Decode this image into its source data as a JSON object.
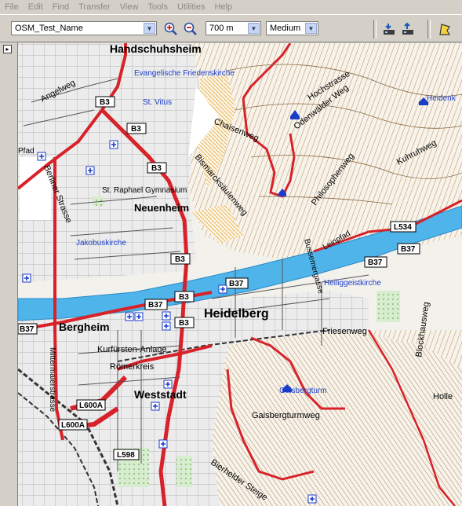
{
  "menu": [
    "File",
    "Edit",
    "Find",
    "Transfer",
    "View",
    "Tools",
    "Utilities",
    "Help"
  ],
  "toolbar": {
    "map_product": "OSM_Test_Name",
    "zoom_scale": "700 m",
    "detail_level": "Medium"
  },
  "map": {
    "places": {
      "handschuhsheim": "Handschuhsheim",
      "neuenheim": "Neuenheim",
      "heidelberg": "Heidelberg",
      "bergheim": "Bergheim",
      "weststadt": "Weststadt",
      "romerkreis": "Römerkreis",
      "kurfursten": "Kurfürsten-Anlage"
    },
    "pois": {
      "ev_kirche": "Evangelische Friedenskirche",
      "st_vitus": "St. Vitus",
      "st_raphael": "St. Raphael Gymnasium",
      "jakobus": "Jakobuskirche",
      "heiliggeist": "Heiliggeistkirche",
      "gaisbergturm": "Gaisbergturm",
      "heidenk": "Heidenk"
    },
    "streets": {
      "angelweg": "Angelweg",
      "chaisenweg": "Chaisenweg",
      "bismarck": "Bismarcksäulenweg",
      "hochstrasse": "Hochstrasse",
      "odenwalder": "Odenwälder Weg",
      "philosophen": "Philosophenweg",
      "kuhruhweg": "Kuhruhweg",
      "berliner": "Berliner Strasse",
      "bussemer": "Bussemergasse",
      "leinpfad": "Leinpfad",
      "friesenweg": "Friesenweg",
      "gaisbergturmweg": "Gaisbergturmweg",
      "blockhausweg": "Blockhausweg",
      "hollen": "Holle",
      "bierhelder": "Bierhelder Steige",
      "mittermaier": "Mittermaierstrasse",
      "pfad": "Pfad"
    },
    "road_shields": {
      "b3": "B3",
      "b37": "B37",
      "l534": "L534",
      "l600a": "L600A",
      "l598": "L598"
    }
  }
}
